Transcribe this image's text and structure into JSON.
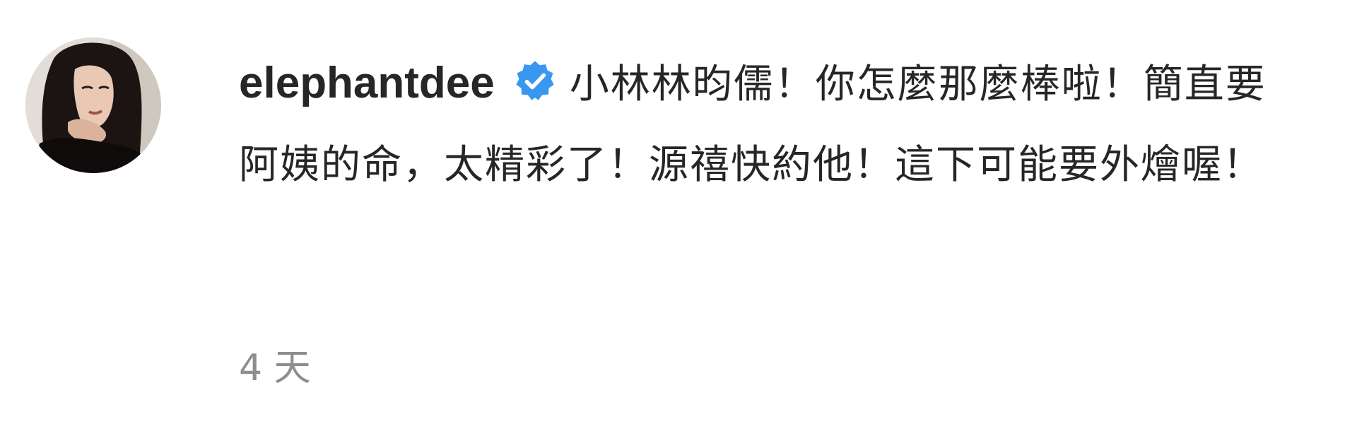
{
  "comment": {
    "avatar_icon": "user-avatar-photo",
    "username": "elephantdee",
    "verified_icon": "verified-badge-icon",
    "verified_color": "#3897f0",
    "text": "小林林昀儒！你怎麼那麼棒啦！簡直要阿姨的命，太精彩了！源禧快約他！這下可能要外燴喔！",
    "timestamp": "4 天"
  }
}
